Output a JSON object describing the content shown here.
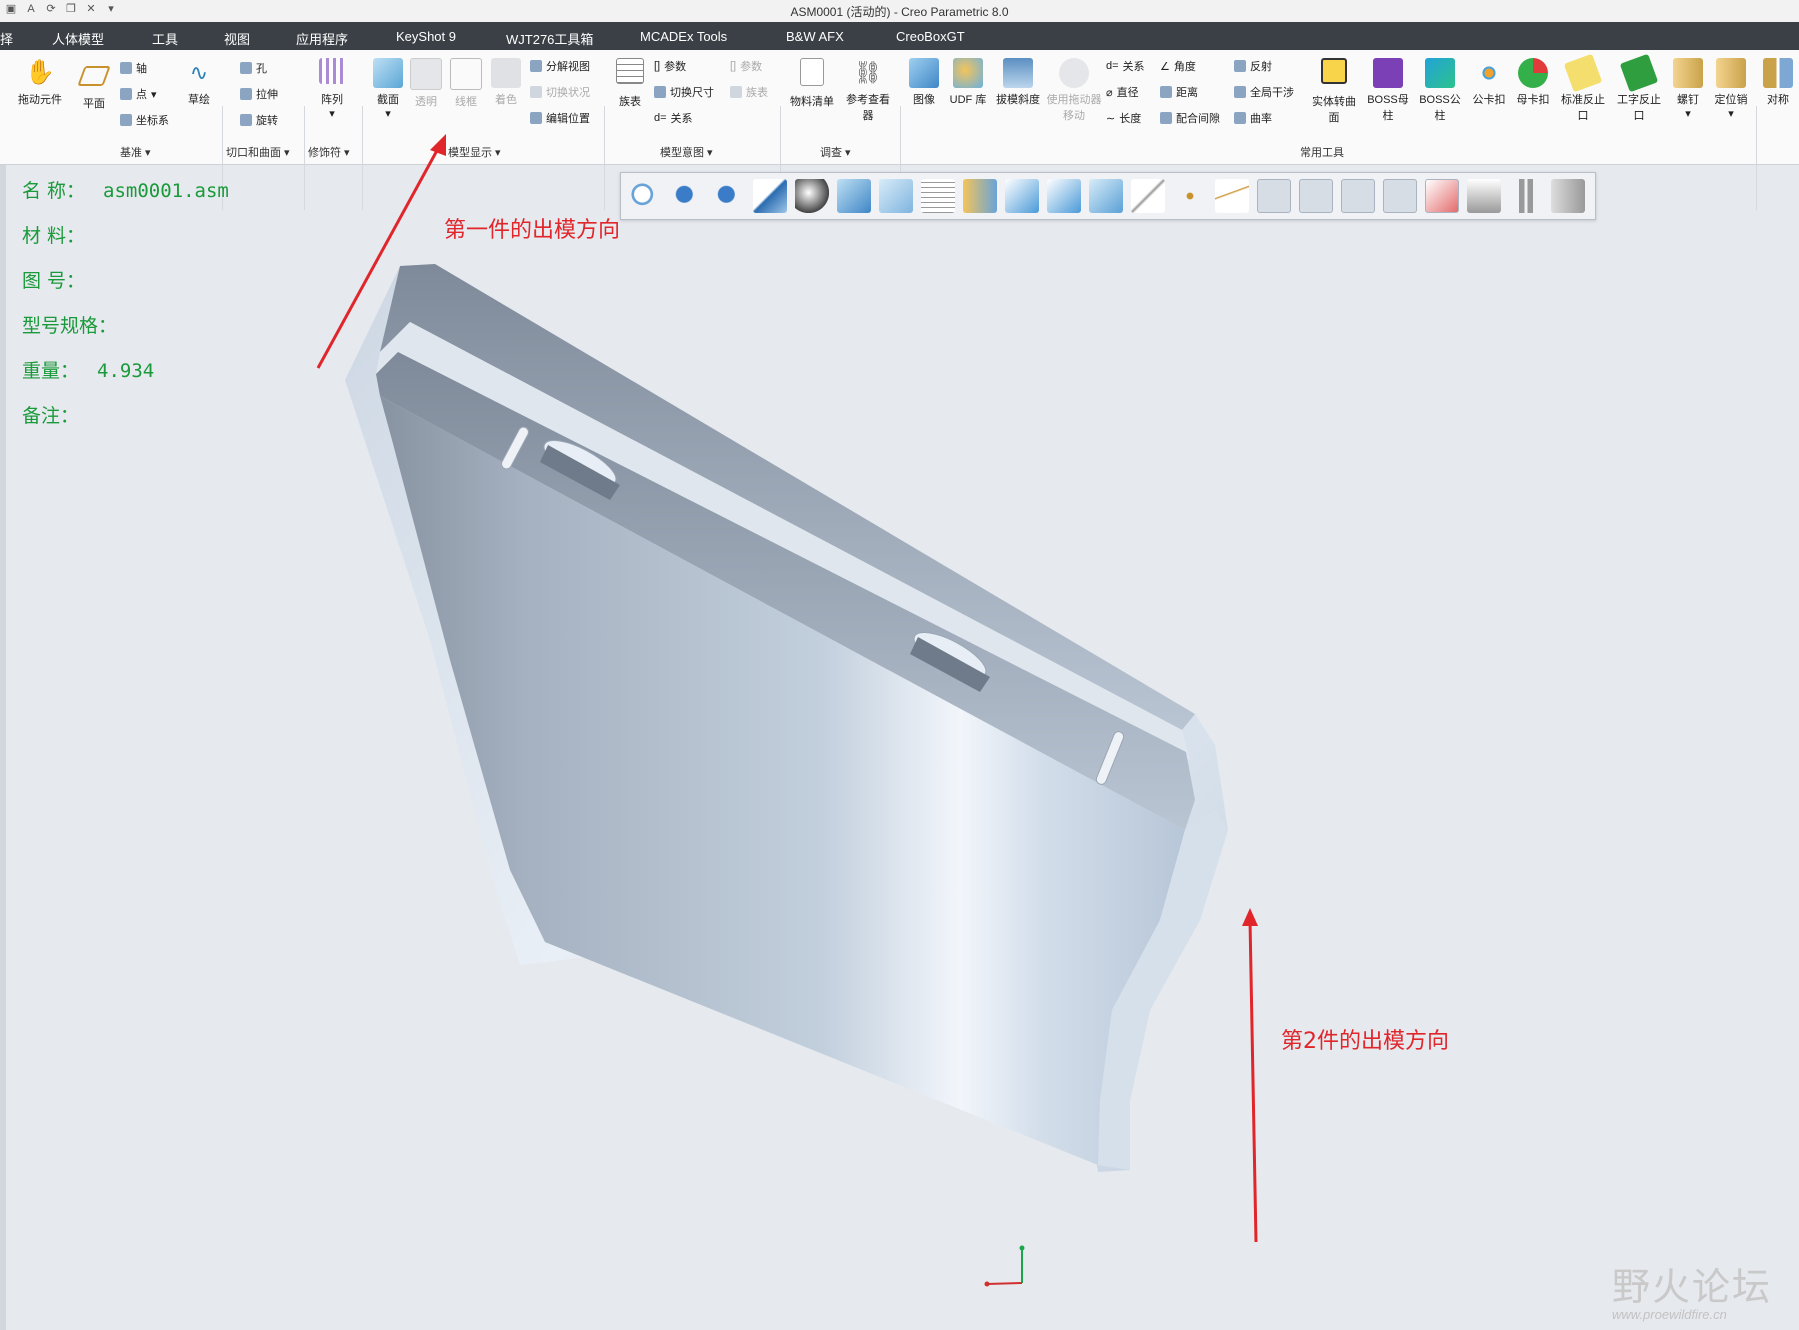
{
  "window": {
    "title": "ASM0001 (活动的) - Creo Parametric 8.0",
    "quick_access": [
      "save-icon",
      "text-icon",
      "regen-icon",
      "window-icon",
      "close-window-icon",
      "more-icon"
    ]
  },
  "menu": [
    "择",
    "人体模型",
    "工具",
    "视图",
    "应用程序",
    "KeyShot 9",
    "WJT276工具箱",
    "MCADEx Tools",
    "B&W AFX",
    "CreoBoxGT"
  ],
  "ribbon": {
    "drag": "拖动元件",
    "plane": "平面",
    "axis": "轴",
    "point": "点",
    "csys": "坐标系",
    "sketch": "草绘",
    "datum_group": "基准",
    "hole": "孔",
    "extrude": "拉伸",
    "revolve": "旋转",
    "cut_group": "切口和曲面",
    "pattern": "阵列",
    "modifier_group": "修饰符",
    "section": "截面",
    "transparent": "透明",
    "wireframe": "线框",
    "shade": "着色",
    "explode": "分解视图",
    "toggle_state": "切换状况",
    "edit_pos": "编辑位置",
    "display_group": "模型显示",
    "family_table": "族表",
    "params": "参数",
    "switch_dim": "切换尺寸",
    "relations": "关系",
    "params2": "参数",
    "family2": "族表",
    "intent_group": "模型意图",
    "bom": "物料清单",
    "ref_viewer": "参考查看器",
    "investigate_group": "调查",
    "image": "图像",
    "udf": "UDF 库",
    "draft": "拔模斜度",
    "drag_move": "使用拖动器移动",
    "rel2": "关系",
    "diameter": "直径",
    "length": "长度",
    "angle": "角度",
    "distance": "距离",
    "clearance": "配合间隙",
    "reflect": "反射",
    "global_interf": "全局干涉",
    "curvature": "曲率",
    "solid_surf": "实体转曲面",
    "boss_female": "BOSS母柱",
    "boss_male": "BOSS公柱",
    "male_clip": "公卡扣",
    "female_clip": "母卡扣",
    "std_stop": "标准反止口",
    "step_stop": "工字反止口",
    "screw": "螺钉",
    "locate_pin": "定位销",
    "symmetry": "对称",
    "common_group": "常用工具"
  },
  "info": [
    {
      "label": "名 称：",
      "value": "asm0001.asm"
    },
    {
      "label": "材 料：",
      "value": ""
    },
    {
      "label": "图 号：",
      "value": ""
    },
    {
      "label": "型号规格：",
      "value": ""
    },
    {
      "label": "重量：",
      "value": "4.934"
    },
    {
      "label": "备注：",
      "value": ""
    }
  ],
  "view_toolbar": [
    "refit-icon",
    "zoom-in-icon",
    "zoom-out-icon",
    "repaint-icon",
    "display-style-icon",
    "saved-views-icon",
    "view-manager-icon",
    "perspective-icon",
    "section-icon",
    "spin-center-icon",
    "annotation-icon",
    "plane-display-icon",
    "axis-display-icon",
    "point-display-icon",
    "csys-display-icon",
    "spin-icon",
    "flexible-icon",
    "pause-icon",
    "stop-icon"
  ],
  "annotations": {
    "first": "第一件的出模方向",
    "second": "第2件的出模方向"
  },
  "watermark": {
    "cn": "野火论坛",
    "url": "www.proewildfire.cn"
  },
  "colors": {
    "annotation": "#e1262b",
    "info_text": "#1a9a3a",
    "menubar": "#3b4046"
  }
}
